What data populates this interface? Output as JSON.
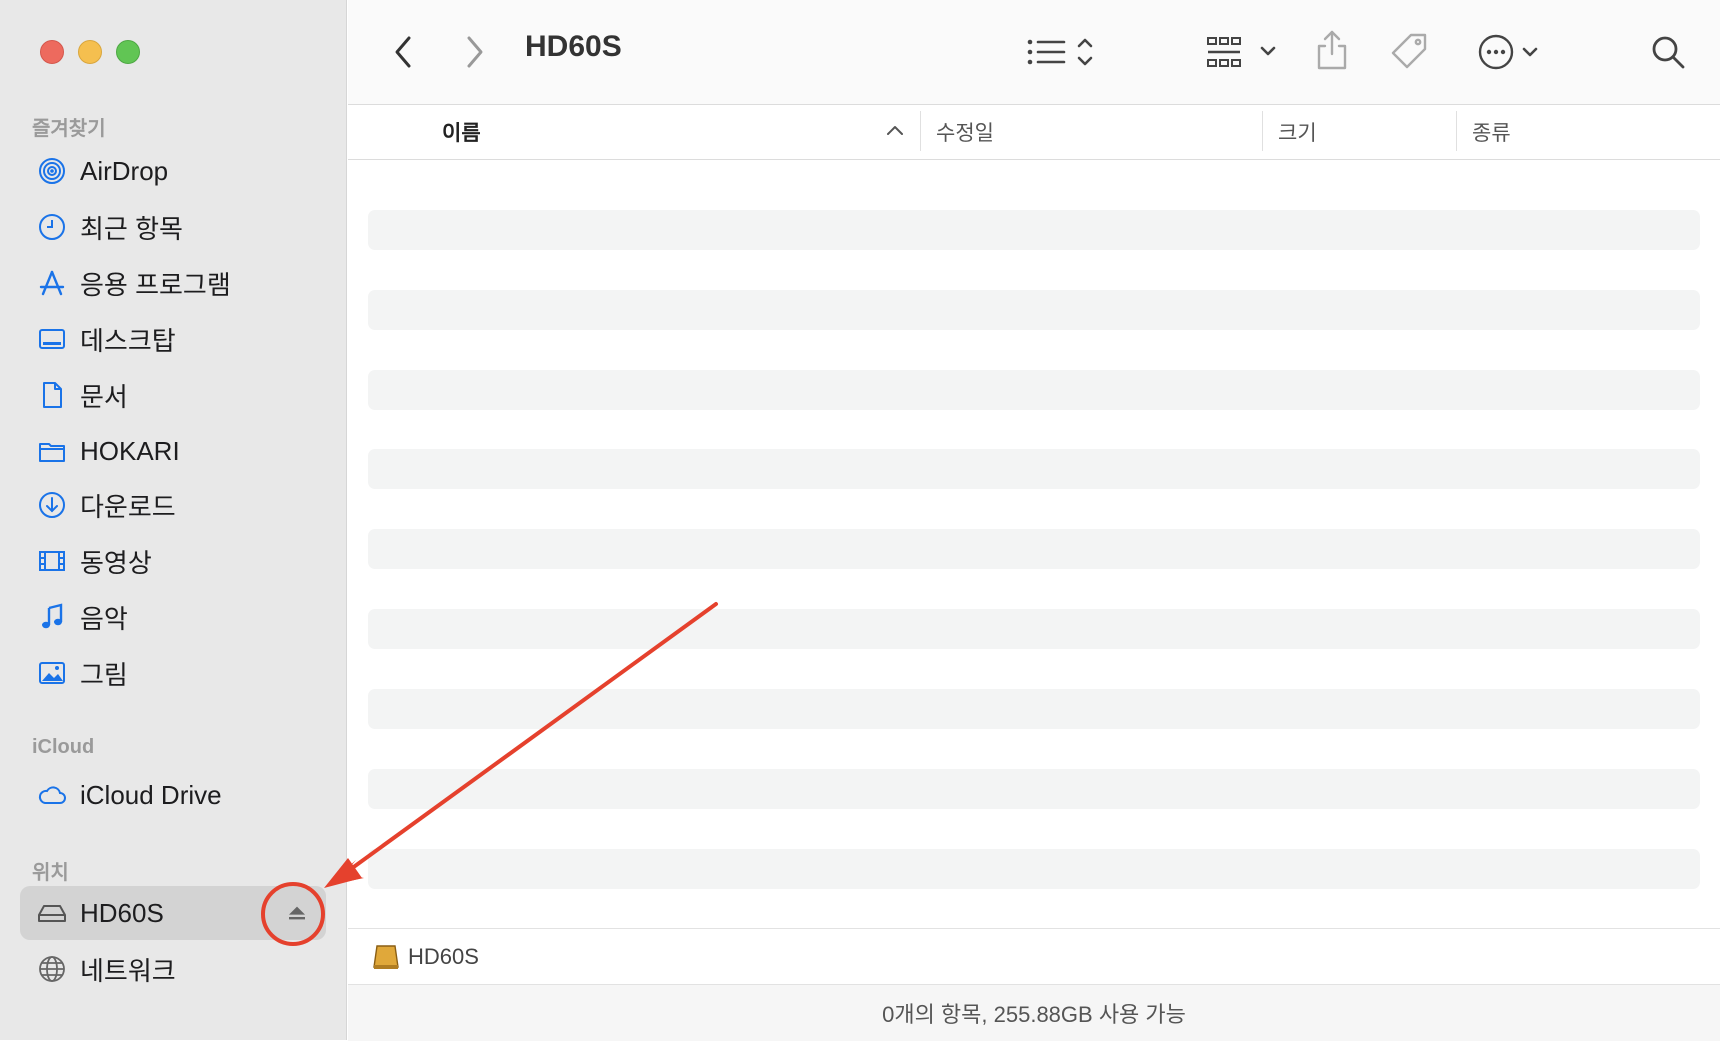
{
  "window": {
    "title": "HD60S"
  },
  "sidebar": {
    "sections": {
      "favorites": "즐겨찾기",
      "icloud": "iCloud",
      "locations": "위치"
    },
    "favorites": [
      {
        "label": "AirDrop",
        "icon": "airdrop-icon"
      },
      {
        "label": "최근 항목",
        "icon": "clock-icon"
      },
      {
        "label": "응용 프로그램",
        "icon": "applications-icon"
      },
      {
        "label": "데스크탑",
        "icon": "desktop-icon"
      },
      {
        "label": "문서",
        "icon": "document-icon"
      },
      {
        "label": "HOKARI",
        "icon": "folder-icon"
      },
      {
        "label": "다운로드",
        "icon": "download-icon"
      },
      {
        "label": "동영상",
        "icon": "film-icon"
      },
      {
        "label": "음악",
        "icon": "music-note-icon"
      },
      {
        "label": "그림",
        "icon": "photo-icon"
      }
    ],
    "icloud": [
      {
        "label": "iCloud Drive",
        "icon": "cloud-icon"
      }
    ],
    "locations": [
      {
        "label": "HD60S",
        "icon": "drive-icon",
        "selected": true,
        "eject": true
      },
      {
        "label": "네트워크",
        "icon": "globe-icon"
      }
    ]
  },
  "columns": {
    "name": "이름",
    "modified": "수정일",
    "size": "크기",
    "kind": "종류"
  },
  "pathbar": {
    "label": "HD60S"
  },
  "status": {
    "text": "0개의 항목, 255.88GB 사용 가능"
  },
  "colors": {
    "accent": "#1a73e8",
    "annotation": "#e5412d",
    "sidebar_bg": "#e8e8e8"
  }
}
